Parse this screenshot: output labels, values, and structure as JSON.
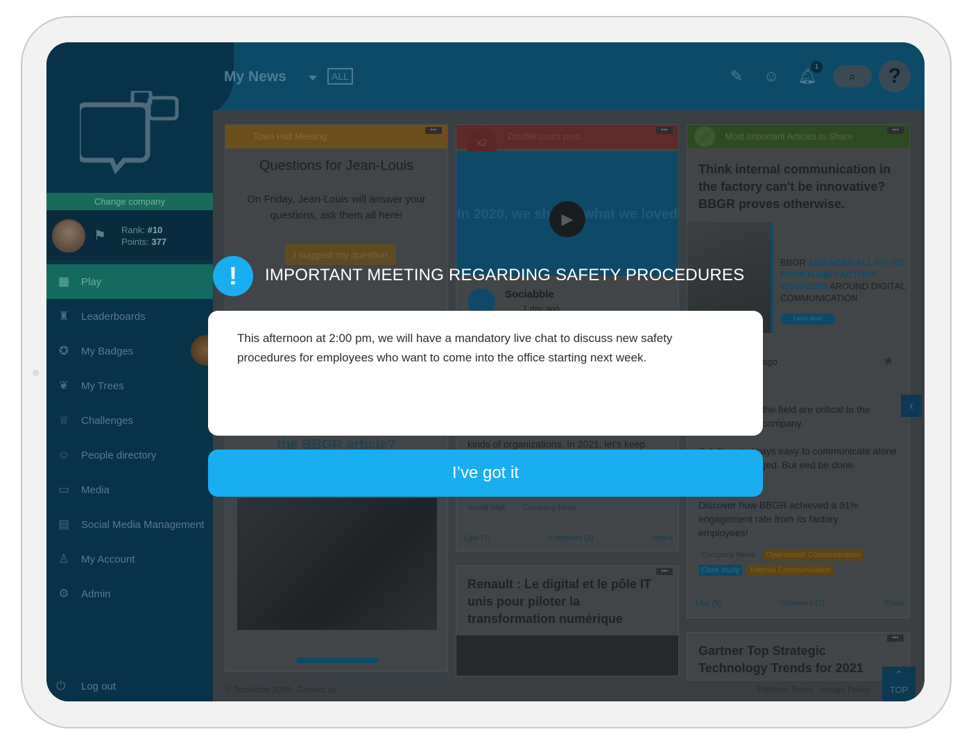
{
  "app": {
    "page_title": "My News",
    "filter_badge": "ALL",
    "notification_count": "1"
  },
  "sidebar": {
    "change_company": "Change company",
    "rank_label": "Rank:",
    "rank_value": "#10",
    "points_label": "Points:",
    "points_value": "377",
    "items": [
      {
        "label": "Play",
        "icon": "grid-icon"
      },
      {
        "label": "Leaderboards",
        "icon": "podium-icon"
      },
      {
        "label": "My Badges",
        "icon": "badge-icon"
      },
      {
        "label": "My Trees",
        "icon": "sprout-icon"
      },
      {
        "label": "Challenges",
        "icon": "trophy-icon"
      },
      {
        "label": "People directory",
        "icon": "people-icon"
      },
      {
        "label": "Media",
        "icon": "folder-icon"
      },
      {
        "label": "Social Media Management",
        "icon": "calendar-icon"
      },
      {
        "label": "My Account",
        "icon": "user-icon"
      },
      {
        "label": "Admin",
        "icon": "gear-icon"
      }
    ],
    "logout": "Log out"
  },
  "cards": {
    "town_hall": {
      "header": "Town Hall Meeting",
      "title": "Questions for Jean-Louis",
      "body": "On Friday, Jean-Louis will answer your questions, ask them all here!",
      "button": "I suggest my question",
      "bottom_title": "the BBGR article?"
    },
    "double_count": {
      "header": "Double count post",
      "video_text": "In 2020, we shared what we loved",
      "author": "Sociabble",
      "time": "1 day ago",
      "body": "kinds of organizations. In 2021, let's keep",
      "tags": [
        "Social Wall",
        "Company News"
      ],
      "like": "Like (7)",
      "comment": "Comment (2)",
      "share": "Share"
    },
    "renault": {
      "title": "Renault : Le digital et le pôle IT unis pour piloter la transformation numérique"
    },
    "important": {
      "header": "Most Important Articles to Share",
      "title": "Think internal communication in the factory can't be innovative? BBGR proves otherwise.",
      "image_text_1": "BBGR",
      "image_text_2": "ENGAGES ALL OF ITS FRONTLINE FACTORY WORKERS",
      "image_text_3": "AROUND DIGITAL COMMUNICATION",
      "image_button": "Learn More",
      "time": "ago",
      "body_1": "the field are critical to the company.",
      "body_2": "But it's not always easy to communicate alone get them engaged. But eed be done.",
      "body_3": "Discover how BBGR achieved a 91% engagement rate from its factory employees!",
      "tags": [
        "Company News",
        "Operational Communication",
        "Case study",
        "Internal Communication"
      ],
      "like": "Like (5)",
      "comment": "Comment (2)",
      "share": "Share"
    },
    "gartner": {
      "title": "Gartner Top Strategic Technology Trends for 2021"
    }
  },
  "footer": {
    "copyright": "© Sociabble 2020",
    "contact": "Contact us",
    "terms": "Platform Terms",
    "policy": "Usage Policy",
    "top": "TOP"
  },
  "modal": {
    "icon": "!",
    "title": "IMPORTANT MEETING REGARDING SAFETY PROCEDURES",
    "body": "This afternoon at 2:00 pm, we will have a mandatory live chat to discuss new safety procedures for employees who want to come into the office starting next week.",
    "button": "I’ve got it"
  },
  "colors": {
    "accent": "#19aef0",
    "sidebar": "#083247",
    "active_nav": "#146a5e"
  }
}
